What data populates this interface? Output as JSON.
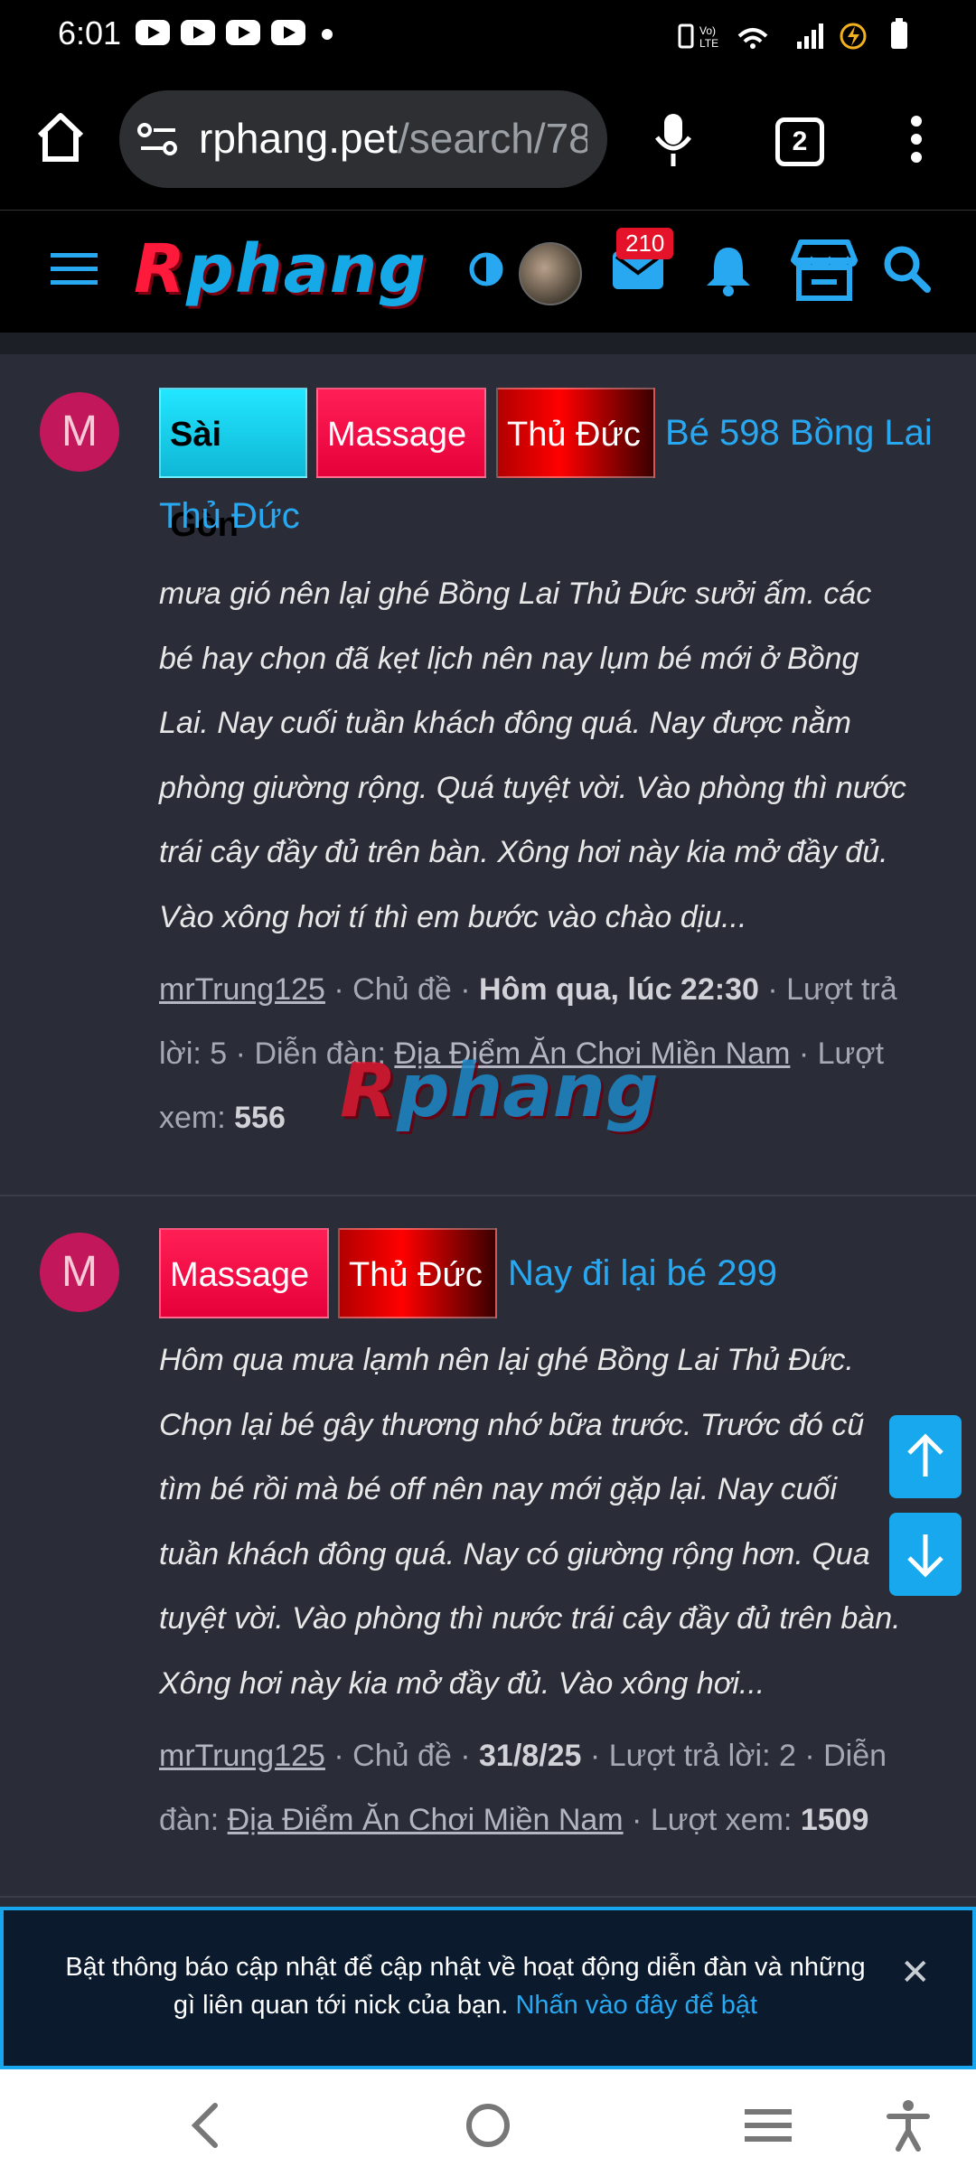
{
  "status_bar": {
    "time": "6:01"
  },
  "browser": {
    "url_domain": "rphang.pet",
    "url_path": "/search/78",
    "tab_count": "2"
  },
  "site_header": {
    "logo_first": "R",
    "logo_rest": "phang",
    "inbox_badge": "210"
  },
  "posts": [
    {
      "avatar_letter": "M",
      "tags": [
        "Sài Gòn",
        "Massage",
        "Thủ Đức"
      ],
      "title_line1": "Bé 598 Bồng Lai",
      "title_line2": "Thủ Đức",
      "excerpt_lines": [
        "mưa gió nên lại ghé Bồng Lai Thủ Đức sưởi ấm. các",
        "bé hay chọn đã kẹt lịch nên nay lụm bé mới ở Bồng",
        "Lai. Nay cuối tuần khách đông quá. Nay được nằm",
        "phòng giường rộng. Quá tuyệt vời. Vào phòng thì nước",
        "trái cây đầy đủ trên bàn. Xông hơi này kia mở đầy đủ.",
        "Vào xông hơi tí thì em bước vào chào dịu..."
      ],
      "author": "mrTrung125",
      "type": "Chủ đề",
      "date": "Hôm qua, lúc 22:30",
      "replies_label": "Lượt trả lời: 5",
      "forum_label": "Diễn đàn:",
      "forum": "Địa Điểm Ăn Chơi Miền Nam",
      "views_label": "Lượt xem:",
      "views": "556"
    },
    {
      "avatar_letter": "M",
      "tags": [
        "Massage",
        "Thủ Đức"
      ],
      "title_line1": "Nay đi lại bé 299",
      "excerpt_lines": [
        "Hôm qua mưa lạmh nên lại ghé Bồng Lai Thủ Đức.",
        "Chọn lại bé gây thương nhớ bữa trước. Trước đó cũ",
        "tìm bé rồi mà bé off nên nay mới gặp lại. Nay cuối",
        "tuần khách đông quá. Nay có giường rộng hơn. Qua",
        "tuyệt vời. Vào phòng thì nước trái cây đầy đủ trên bàn.",
        "Xông hơi này kia mở đầy đủ. Vào xông hơi..."
      ],
      "author": "mrTrung125",
      "type": "Chủ đề",
      "date": "31/8/25",
      "replies_label": "Lượt trả lời: 2",
      "forum_label": "Diễn",
      "forum_label2": "đàn:",
      "forum": "Địa Điểm Ăn Chơi Miền Nam",
      "views_label": "Lượt xem:",
      "views": "1509"
    }
  ],
  "watermark": {
    "first": "R",
    "rest": "phang"
  },
  "notification_banner": {
    "line1": "Bật thông báo cập nhật để cập nhật về hoạt động diễn đàn và những",
    "line2": "gì liên quan tới nick của bạn.",
    "link": "Nhấn vào đây để bật",
    "close": "✕"
  },
  "icons": [
    "youtube-icon",
    "home-icon",
    "site-info-icon",
    "mic-icon",
    "more-vert-icon",
    "menu-icon",
    "theme-toggle-icon",
    "inbox-icon",
    "bell-icon",
    "store-icon",
    "search-icon",
    "arrow-up-icon",
    "arrow-down-icon",
    "back-icon",
    "home-circle-icon",
    "recents-icon",
    "accessibility-icon"
  ],
  "colors": {
    "accent": "#29a8f2",
    "background": "#2a2d38",
    "badge": "#e5132a",
    "avatar": "#c2185b"
  }
}
